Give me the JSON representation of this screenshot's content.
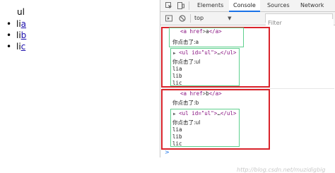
{
  "page": {
    "heading": "ul",
    "items": [
      {
        "prefix": "li",
        "link": "a"
      },
      {
        "prefix": "li",
        "link": "b"
      },
      {
        "prefix": "li",
        "link": "c"
      }
    ]
  },
  "devtools": {
    "tabs": [
      "Elements",
      "Console",
      "Sources",
      "Network"
    ],
    "active_tab": "Console",
    "context": "top",
    "filter_placeholder": "Filter",
    "accent": "#1a73e8",
    "entries": [
      {
        "anchor": {
          "tag_open": "<a href",
          "text": "a",
          "tag_close": "</a>"
        },
        "message": "你点击了:a",
        "ul_summary": {
          "open": "<ul id=\"ul\">",
          "ellipsis": "…",
          "close": "</ul>"
        },
        "log_title": "你点击了:ul",
        "children": [
          "lia",
          "lib",
          "lic"
        ]
      },
      {
        "anchor": {
          "tag_open": "<a href",
          "text": "b",
          "tag_close": "</a>"
        },
        "message": "你点击了:b",
        "ul_summary": {
          "open": "<ul id=\"ul\">",
          "ellipsis": "…",
          "close": "</ul>"
        },
        "log_title": "你点击了:ul",
        "children": [
          "lia",
          "lib",
          "lic"
        ]
      }
    ],
    "prompt": ">",
    "watermark": "http://blog.csdn.net/muzidigbig",
    "highlight_red": "#d9232b",
    "highlight_green": "#5fd08e"
  }
}
